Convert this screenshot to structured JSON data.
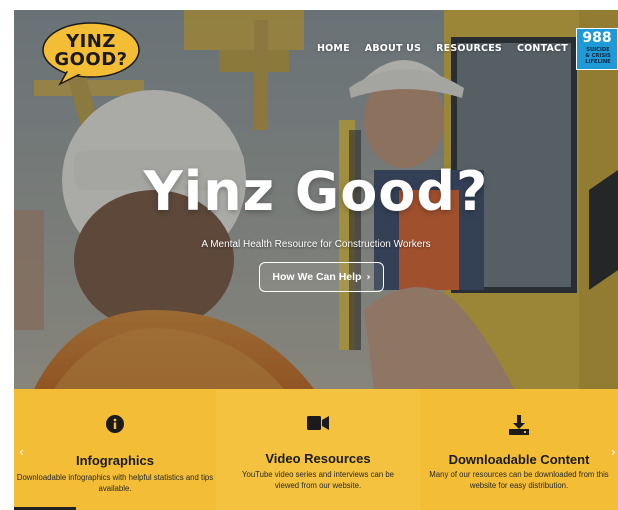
{
  "header": {
    "logo_line1": "YINZ",
    "logo_line2": "GOOD?",
    "logo_bg": "#f3bd35",
    "nav": [
      "HOME",
      "ABOUT US",
      "RESOURCES",
      "CONTACT"
    ],
    "badge": {
      "number": "988",
      "line1": "SUICIDE",
      "line2": "& CRISIS",
      "line3": "LIFELINE",
      "color": "#1f9ad6"
    }
  },
  "hero": {
    "title": "Yinz Good?",
    "subtitle": "A Mental Health Resource for Construction Workers",
    "button_label": "How We Can Help",
    "button_icon": "chevron-right-icon"
  },
  "features": {
    "bg_color": "#f3bd35",
    "prev_arrow": "‹",
    "next_arrow": "›",
    "items": [
      {
        "icon": "info-circle-icon",
        "title": "Infographics",
        "description": "Downloadable infographics with helpful statistics and tips available."
      },
      {
        "icon": "video-camera-icon",
        "title": "Video Resources",
        "description": "YouTube video series and interviews can be viewed from our website."
      },
      {
        "icon": "download-icon",
        "title": "Downloadable Content",
        "description": "Many of our resources can be downloaded from this website for easy distribution."
      }
    ]
  }
}
